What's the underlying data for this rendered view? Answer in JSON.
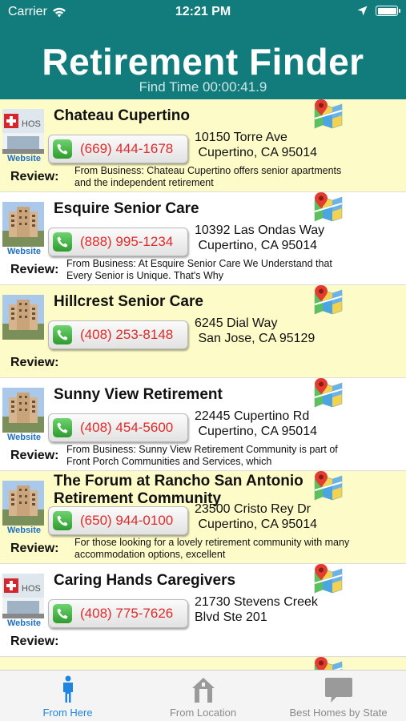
{
  "status": {
    "carrier": "Carrier",
    "time": "12:21 PM"
  },
  "header": {
    "title": "Retirement Finder",
    "find_time": "Find Time 00:00:41.9"
  },
  "listings": [
    {
      "name": "Chateau Cupertino",
      "phone": "(669) 444-1678",
      "address_line1": "10150 Torre Ave",
      "address_line2": " Cupertino, CA 95014",
      "website_label": "Website",
      "review_label": "Review:",
      "review": "From Business: Chateau Cupertino offers senior apartments and the independent retirement"
    },
    {
      "name": "Esquire Senior Care",
      "phone": "(888) 995-1234",
      "address_line1": "10392 Las Ondas Way",
      "address_line2": " Cupertino, CA 95014",
      "website_label": "Website",
      "review_label": "Review:",
      "review": "From Business: At Esquire Senior Care We Understand that Every Senior is Unique. That's Why"
    },
    {
      "name": "Hillcrest Senior Care",
      "phone": "(408) 253-8148",
      "address_line1": "6245 Dial Way",
      "address_line2": " San Jose, CA 95129",
      "website_label": "",
      "review_label": "Review:",
      "review": ""
    },
    {
      "name": "Sunny View Retirement",
      "phone": "(408) 454-5600",
      "address_line1": "22445 Cupertino Rd",
      "address_line2": " Cupertino, CA 95014",
      "website_label": "Website",
      "review_label": "Review:",
      "review": "From Business: Sunny View Retirement Community is part of Front Porch Communities and Services, which"
    },
    {
      "name": "The Forum at Rancho San Antonio Retirement Community",
      "phone": "(650) 944-0100",
      "address_line1": "23500 Cristo Rey Dr",
      "address_line2": " Cupertino, CA 95014",
      "website_label": "Website",
      "review_label": "Review:",
      "review": "For those looking for a lovely retirement community with many accommodation options, excellent"
    },
    {
      "name": "Caring Hands Caregivers",
      "phone": "(408) 775-7626",
      "address_line1": "21730 Stevens Creek",
      "address_line2": "Blvd Ste 201",
      "website_label": "Website",
      "review_label": "Review:",
      "review": ""
    }
  ],
  "tabs": [
    {
      "label": "From Here",
      "icon": "person-icon",
      "active": true
    },
    {
      "label": "From Location",
      "icon": "house-icon",
      "active": false
    },
    {
      "label": "Best Homes by State",
      "icon": "speech-bubble-icon",
      "active": false
    }
  ],
  "colors": {
    "header": "#127b7b",
    "row_yellow": "#fdfbc8",
    "phone_text": "#e02b2b",
    "link": "#1e6fc8",
    "tab_active": "#1e86e0"
  }
}
